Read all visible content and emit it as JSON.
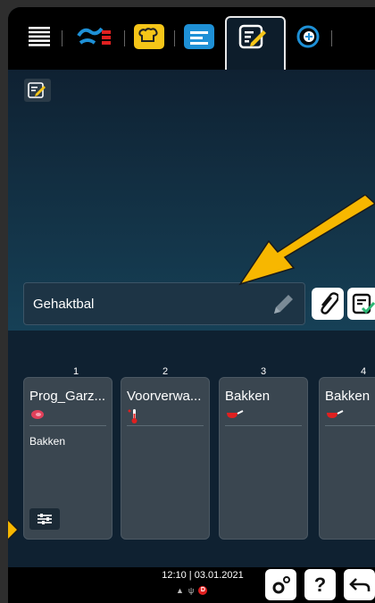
{
  "tabs": [
    {
      "icon": "menu-icon"
    },
    {
      "icon": "intelligent-cooking-icon"
    },
    {
      "icon": "chef-hat-icon"
    },
    {
      "icon": "program-list-icon"
    },
    {
      "icon": "program-edit-icon",
      "active": true
    },
    {
      "icon": "cleaning-icon"
    }
  ],
  "program": {
    "name": "Gehaktbal",
    "edit_icon": "program-edit-icon"
  },
  "steps": [
    {
      "number": "1",
      "title": "Prog_Garz...",
      "icon": "meat-icon",
      "subtitle": "Bakken",
      "has_settings": true
    },
    {
      "number": "2",
      "title": "Voorverwa...",
      "icon": "thermometer-icon",
      "subtitle": "",
      "has_settings": false
    },
    {
      "number": "3",
      "title": "Bakken",
      "icon": "pan-icon",
      "subtitle": "",
      "has_settings": false
    },
    {
      "number": "4",
      "title": "Bakken",
      "icon": "pan-icon",
      "subtitle": "",
      "has_settings": false
    }
  ],
  "status": {
    "time": "12:10",
    "date": "03.01.2021"
  },
  "colors": {
    "accent_yellow": "#f5c518",
    "accent_blue": "#1e90d6",
    "accent_red": "#e02020",
    "arrow": "#f7b700"
  }
}
